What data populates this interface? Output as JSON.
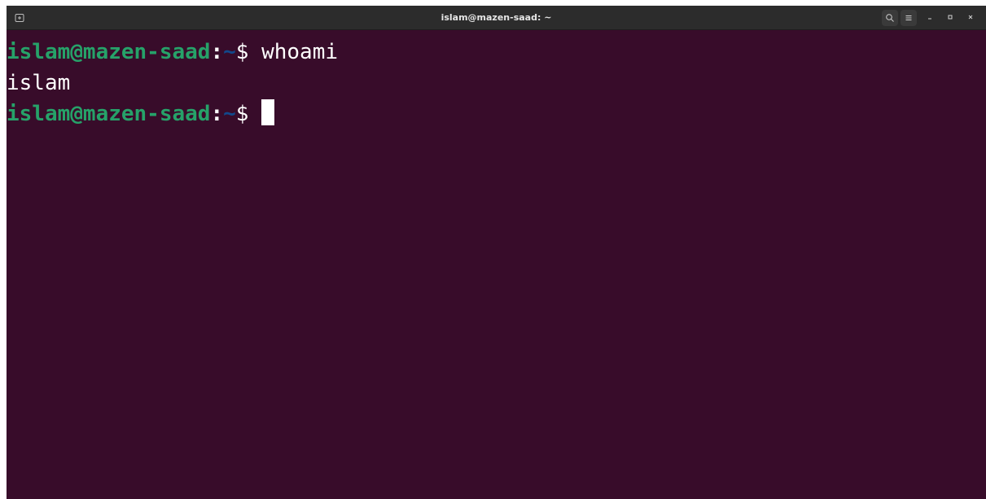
{
  "window": {
    "title": "islam@mazen-saad: ~"
  },
  "titlebar": {
    "new_tab_icon": "terminal-tab-icon",
    "search_icon": "search-icon",
    "menu_icon": "hamburger-menu-icon",
    "minimize_icon": "minimize-icon",
    "maximize_icon": "maximize-icon",
    "close_icon": "close-icon"
  },
  "terminal": {
    "lines": [
      {
        "user_host": "islam@mazen-saad",
        "colon": ":",
        "path": "~",
        "prompt_symbol": "$ ",
        "command": "whoami"
      },
      {
        "output": "islam"
      },
      {
        "user_host": "islam@mazen-saad",
        "colon": ":",
        "path": "~",
        "prompt_symbol": "$ ",
        "command": ""
      }
    ]
  },
  "colors": {
    "background": "#380c2a",
    "prompt_user": "#26a269",
    "prompt_path": "#12488b",
    "text": "#ffffff",
    "titlebar": "#2c2c2c"
  }
}
